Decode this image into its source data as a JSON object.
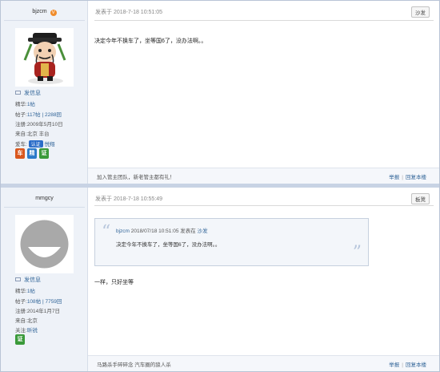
{
  "post1": {
    "user": {
      "name": "bjzcm",
      "badge_icon": "v-badge-icon",
      "send_msg": "发信息"
    },
    "stats": {
      "jinghua_label": "精华:",
      "jinghua_val": "1帖",
      "tiezi_label": "帖子:",
      "tiezi_val": "117帖 | 2288回",
      "zhuce_label": "注册:",
      "zhuce_val": "2009年5月10日",
      "laizi_label": "来自:",
      "laizi_val": "北京 丰台",
      "aiche_label": "爱车:",
      "aiche_tag": "认证",
      "aiche_val": "悦翔"
    },
    "badges": [
      "车",
      "精",
      "证"
    ],
    "time": "发表于 2018-7-18 10:51:05",
    "floor": "沙发",
    "content": "决定今年不换车了，坐等国6了，没办法啊。。",
    "signature": "加入管主团队，新老管主都有礼！",
    "report": "举报",
    "reply": "回复本楼"
  },
  "post2": {
    "user": {
      "name": "mmgcy",
      "send_msg": "发信息"
    },
    "stats": {
      "jinghua_label": "精华:",
      "jinghua_val": "1帖",
      "tiezi_label": "帖子:",
      "tiezi_val": "108帖 | 7759回",
      "zhuce_label": "注册:",
      "zhuce_val": "2014年1月7日",
      "laizi_label": "来自:",
      "laizi_val": "北京",
      "guanzhu_label": "关注:",
      "guanzhu_val": "昕锐"
    },
    "badges": [
      "证"
    ],
    "time": "发表于 2018-7-18 10:55:49",
    "floor": "板凳",
    "quote": {
      "author": "bjzcm",
      "meta": "2018/07/18 10:51:05 发表在",
      "floor_link": "沙发",
      "text": "决定今年不换车了，坐等国6了，没办法啊。。"
    },
    "content": "一样，只好坐等",
    "signature": "马路杀手碎碎念 汽车圈的狼人杀",
    "report": "举报",
    "reply": "回复本楼"
  },
  "colors": {
    "link": "#336699",
    "side_bg": "#eef2f8",
    "sep": "#c8d3e4"
  }
}
